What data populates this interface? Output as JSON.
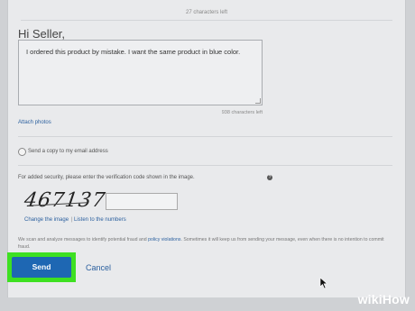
{
  "form": {
    "chars_top": "27 characters left",
    "greeting": "Hi Seller,",
    "message": "I ordered this product by mistake. I want the same product in blue color.",
    "chars_left": "938 characters left",
    "attach_photos": "Attach photos",
    "copy_label": "Send a copy to my email address",
    "security_text": "For added security, please enter the verification code shown in the image.",
    "help_icon": "?",
    "captcha_code": "467137",
    "change_image": "Change the image",
    "separator": "|",
    "listen_numbers": "Listen to the numbers",
    "scan_note_start": "We scan and analyze messages to identify potential fraud and ",
    "scan_note_link": "policy violations",
    "scan_note_end": ". Sometimes it will keep us from sending your message, even when there is no intention to commit fraud.",
    "send_label": "Send",
    "cancel_label": "Cancel"
  },
  "watermark": {
    "wiki": "wiki",
    "how": "How"
  },
  "colors": {
    "accent": "#1e67b3",
    "highlight": "#3ee022",
    "link": "#2a5f9e"
  },
  "icons": {
    "pointer": "mouse-pointer-icon"
  }
}
